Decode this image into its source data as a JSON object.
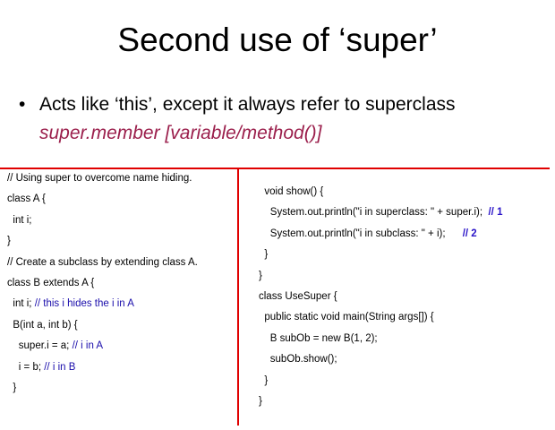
{
  "slide": {
    "title": "Second use of ‘super’",
    "bullet": {
      "marker": "•",
      "text": "Acts like ‘this’, except it always refer to superclass",
      "subtext": "super.member [variable/method()]"
    }
  },
  "colors": {
    "accent_red": "#e00000",
    "subtext_maroon": "#9b1f4c",
    "comment_blue": "#1a0dab"
  },
  "code_left": [
    {
      "code": "// Using super to overcome name hiding.",
      "comment": ""
    },
    {
      "code": "class A {",
      "comment": ""
    },
    {
      "code": "  int i;",
      "comment": ""
    },
    {
      "code": "}",
      "comment": ""
    },
    {
      "code": "// Create a subclass by extending class A.",
      "comment": ""
    },
    {
      "code": "class B extends A {",
      "comment": ""
    },
    {
      "code": "  int i; ",
      "comment": "// this i hides the i in A"
    },
    {
      "code": "  B(int a, int b) {",
      "comment": ""
    },
    {
      "code": "    super.i = a; ",
      "comment": "// i in A"
    },
    {
      "code": "    i = b; ",
      "comment": "// i in B"
    },
    {
      "code": "  }",
      "comment": ""
    }
  ],
  "code_right": [
    {
      "code": "  void show() {",
      "comment": ""
    },
    {
      "code": "    System.out.println(\"i in superclass: \" + super.i);  ",
      "comment": "// 1"
    },
    {
      "code": "    System.out.println(\"i in subclass: \" + i);      ",
      "comment": "// 2"
    },
    {
      "code": "  }",
      "comment": ""
    },
    {
      "code": "}",
      "comment": ""
    },
    {
      "code": "class UseSuper {",
      "comment": ""
    },
    {
      "code": "  public static void main(String args[]) {",
      "comment": ""
    },
    {
      "code": "    B subOb = new B(1, 2);",
      "comment": ""
    },
    {
      "code": "    subOb.show();",
      "comment": ""
    },
    {
      "code": "  }",
      "comment": ""
    },
    {
      "code": "}",
      "comment": ""
    }
  ]
}
